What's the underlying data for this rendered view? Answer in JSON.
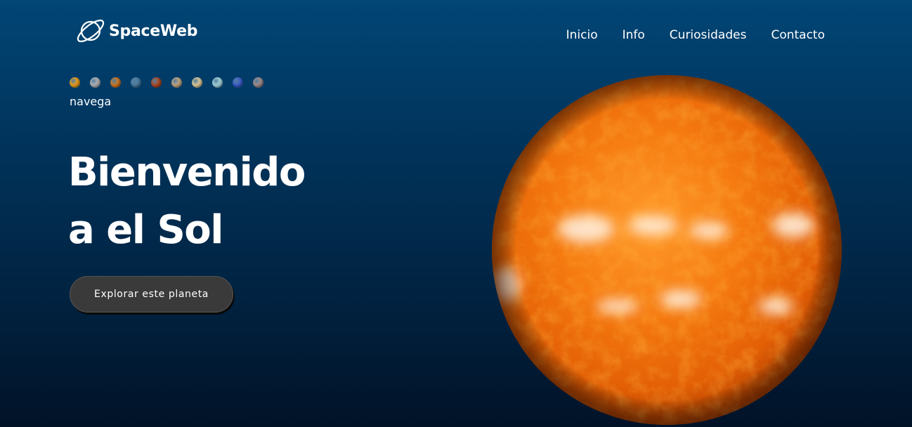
{
  "header": {
    "logo_text": "SpaceWeb",
    "logo_icon": "planet-ring-icon"
  },
  "nav": {
    "items": [
      {
        "label": "Inicio"
      },
      {
        "label": "Info"
      },
      {
        "label": "Curiosidades"
      },
      {
        "label": "Contacto"
      }
    ]
  },
  "planet_nav": {
    "label": "navega",
    "planets": [
      {
        "name": "sun",
        "color": "#f2a21c"
      },
      {
        "name": "mercury",
        "color": "#b9b9bb"
      },
      {
        "name": "venus",
        "color": "#d67a22"
      },
      {
        "name": "earth",
        "color": "#4d7fa6"
      },
      {
        "name": "mars",
        "color": "#b34a26"
      },
      {
        "name": "jupiter",
        "color": "#c9a984"
      },
      {
        "name": "saturn",
        "color": "#e6cf9c"
      },
      {
        "name": "uranus",
        "color": "#a9dbe4"
      },
      {
        "name": "neptune",
        "color": "#3d5fd1"
      },
      {
        "name": "pluto",
        "color": "#a58f8f"
      }
    ]
  },
  "hero": {
    "title_line1": "Bienvenido",
    "title_line2": "a el Sol",
    "button_label": "Explorar este planeta"
  },
  "colors": {
    "background_top": "#014676",
    "background_bottom": "#011227",
    "button_bg": "#3a3a3a",
    "sun_core": "#f06a05"
  }
}
